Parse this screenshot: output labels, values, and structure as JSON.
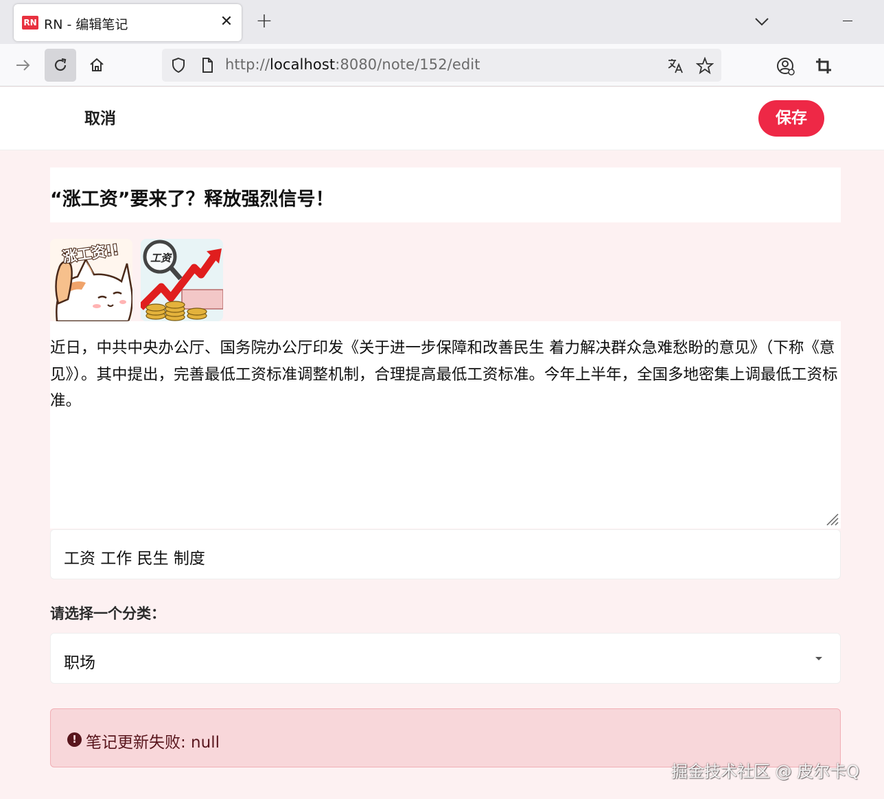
{
  "browser": {
    "tab_favicon": "RN",
    "tab_title": "RN - 编辑笔记",
    "url": {
      "scheme": "http://",
      "host": "localhost",
      "rest": ":8080/note/152/edit"
    }
  },
  "header": {
    "cancel_label": "取消",
    "save_label": "保存"
  },
  "note": {
    "title": "“涨工资”要来了？释放强烈信号！",
    "images": [
      {
        "caption": "涨工资!!",
        "icon": "cat-cheering-image"
      },
      {
        "caption": "工资",
        "icon": "salary-growth-chart-image"
      }
    ],
    "content": "近日，中共中央办公厅、国务院办公厅印发《关于进一步保障和改善民生 着力解决群众急难愁盼的意见》（下称《意见》）。其中提出，完善最低工资标准调整机制，合理提高最低工资标准。今年上半年，全国多地密集上调最低工资标准。",
    "tags": "工资 工作 民生 制度"
  },
  "category": {
    "label": "请选择一个分类：",
    "selected": "职场"
  },
  "alert": {
    "icon": "exclamation-circle-icon",
    "message": "笔记更新失败: null"
  },
  "watermark": "掘金技术社区 @ 皮尔卡Q",
  "colors": {
    "accent": "#ee2846",
    "page_bg": "#fdf1f2",
    "alert_bg": "#f8d7da",
    "alert_text": "#58151c"
  }
}
